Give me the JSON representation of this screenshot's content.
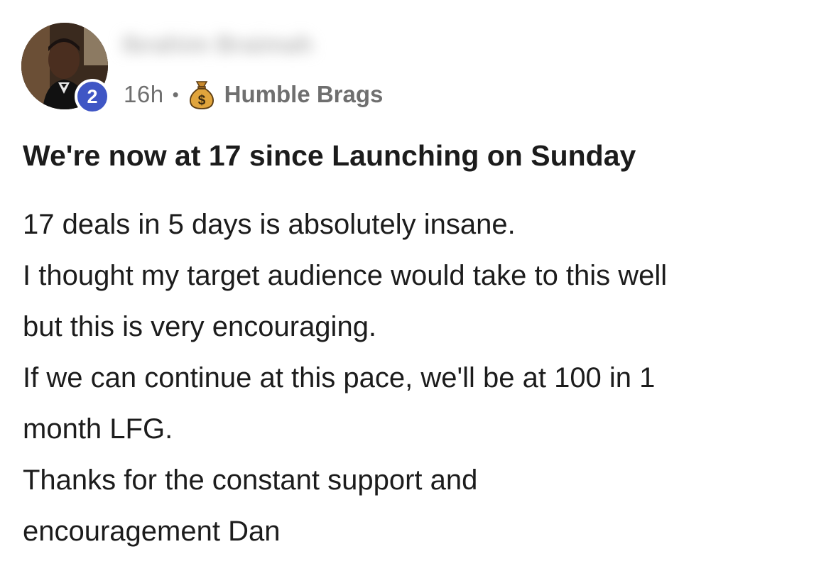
{
  "author": {
    "name": "Ibrahim Braimah",
    "level": "2"
  },
  "meta": {
    "time": "16h",
    "separator": "•",
    "group_icon": "money-bag-icon",
    "group_name": "Humble Brags"
  },
  "post": {
    "title": "We're now at 17 since Launching on Sunday",
    "body_lines": [
      "17 deals in 5 days is absolutely insane.",
      "I thought my target audience would take to this well",
      "but this is very encouraging.",
      "If we can continue at this pace, we'll be at 100 in 1",
      "month LFG.",
      "Thanks for the constant support and",
      "encouragement Dan"
    ]
  },
  "colors": {
    "badge": "#3f56c5",
    "text_primary": "#1c1c1c",
    "text_meta": "#6f6f6f"
  }
}
